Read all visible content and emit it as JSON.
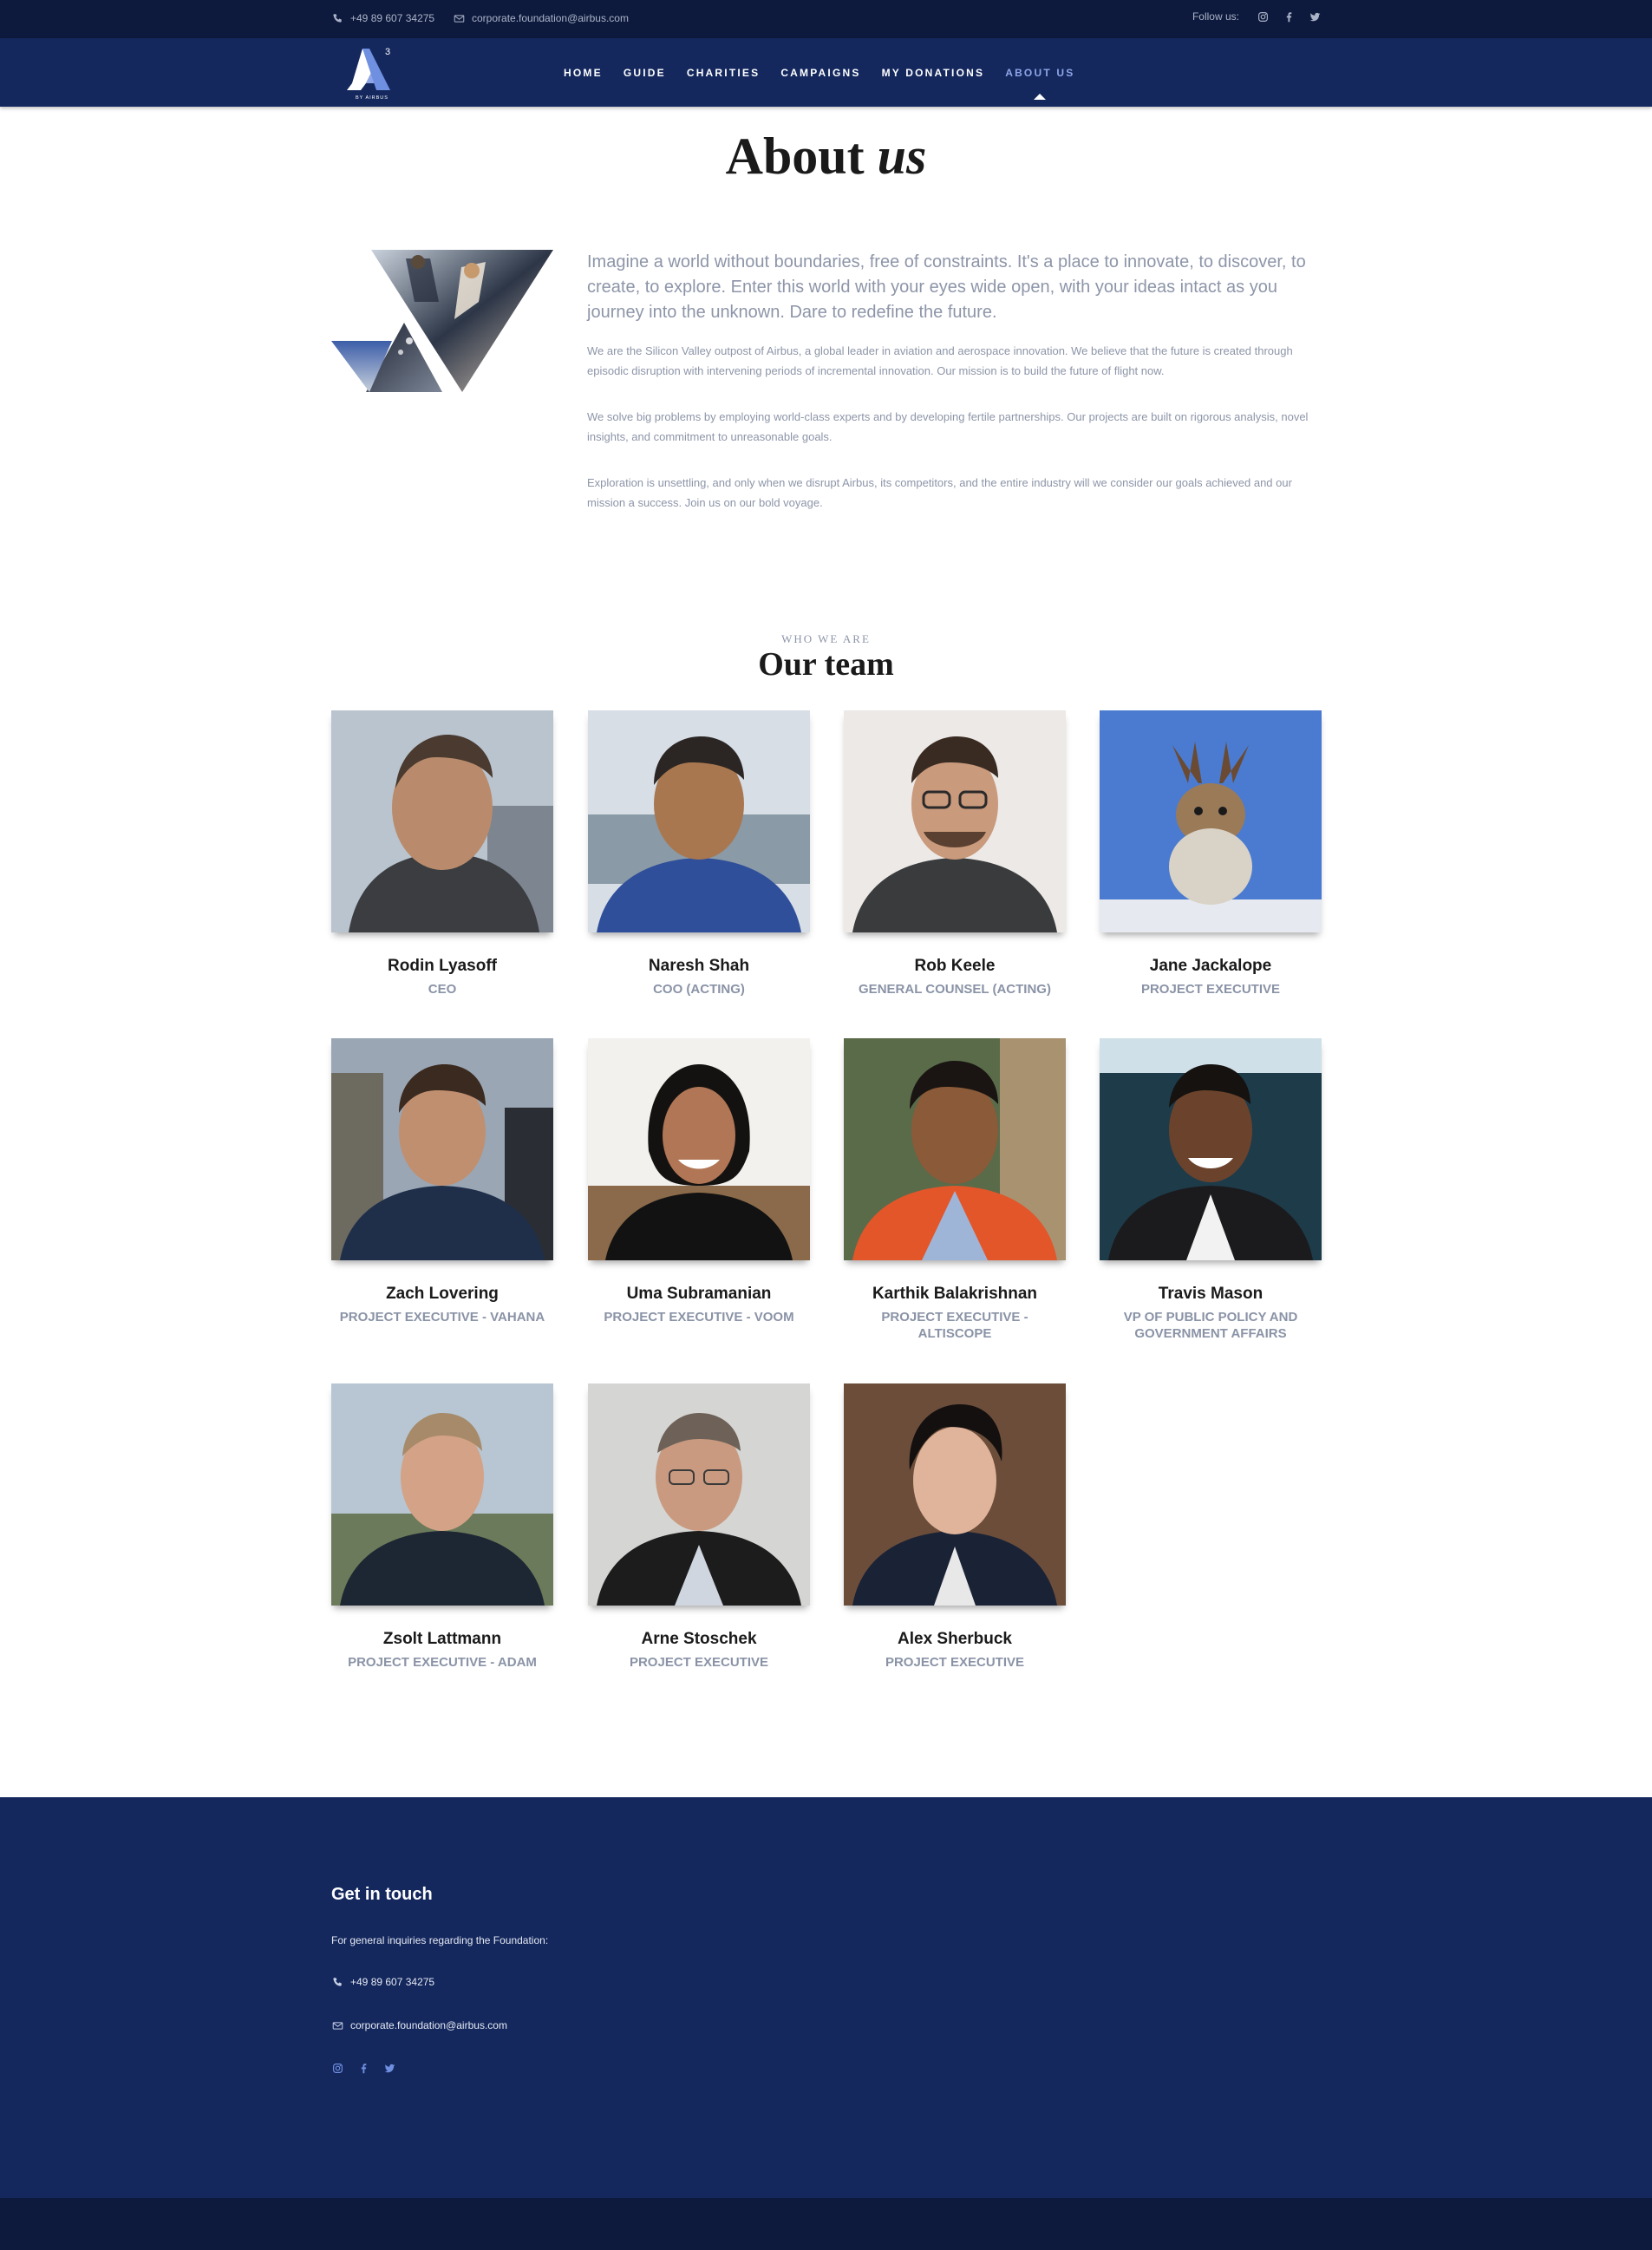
{
  "topbar": {
    "phone": "+49 89 607 34275",
    "email": "corporate.foundation@airbus.com",
    "follow_label": "Follow us:",
    "social_icons": [
      "instagram-icon",
      "facebook-icon",
      "twitter-icon"
    ]
  },
  "brand": {
    "logo_caption": "BY AIRBUS",
    "logo_superscript": "3"
  },
  "nav": {
    "items": [
      "HOME",
      "GUIDE",
      "CHARITIES",
      "CAMPAIGNS",
      "MY DONATIONS",
      "ABOUT US"
    ],
    "active": "ABOUT US"
  },
  "page": {
    "title_main": "About",
    "title_em": "us"
  },
  "intro": {
    "lead": "Imagine a world without boundaries, free of constraints. It's a place to innovate, to discover, to create, to explore. Enter this world with your eyes wide open, with your ideas intact as you journey into the unknown. Dare to redefine the future.",
    "paragraphs": [
      "We are the Silicon Valley outpost of Airbus, a global leader in aviation and aerospace innovation. We believe that the future is created through episodic disruption with intervening periods of incremental innovation. Our mission is to build the future of flight now.",
      "We solve big problems by employing world-class experts and by developing fertile partnerships. Our projects are built on rigorous analysis, novel insights, and commitment to unreasonable goals.",
      "Exploration is unsettling, and only when we disrupt Airbus, its competitors, and the entire industry will we consider our goals achieved and our mission a success. Join us on our bold voyage."
    ]
  },
  "team": {
    "eyebrow": "WHO WE ARE",
    "title": "Our team",
    "members": [
      {
        "name": "Rodin Lyasoff",
        "role": "CEO"
      },
      {
        "name": "Naresh Shah",
        "role": "COO (ACTING)"
      },
      {
        "name": "Rob Keele",
        "role": "GENERAL COUNSEL (ACTING)"
      },
      {
        "name": "Jane Jackalope",
        "role": "PROJECT EXECUTIVE"
      },
      {
        "name": "Zach Lovering",
        "role": "PROJECT EXECUTIVE - VAHANA"
      },
      {
        "name": "Uma Subramanian",
        "role": "PROJECT EXECUTIVE - VOOM"
      },
      {
        "name": "Karthik Balakrishnan",
        "role": "PROJECT EXECUTIVE - ALTISCOPE"
      },
      {
        "name": "Travis Mason",
        "role": "VP OF PUBLIC POLICY AND GOVERNMENT AFFAIRS"
      },
      {
        "name": "Zsolt Lattmann",
        "role": "PROJECT EXECUTIVE - ADAM"
      },
      {
        "name": "Arne Stoschek",
        "role": "PROJECT EXECUTIVE"
      },
      {
        "name": "Alex Sherbuck",
        "role": "PROJECT EXECUTIVE"
      }
    ]
  },
  "footer": {
    "title": "Get in touch",
    "subtitle": "For general inquiries regarding the Foundation:",
    "phone": "+49 89 607 34275",
    "email": "corporate.foundation@airbus.com",
    "social_icons": [
      "instagram-icon",
      "facebook-icon",
      "twitter-icon"
    ]
  },
  "colors": {
    "topbar": "#0e1a3d",
    "navbar": "#14285e",
    "accent": "#8ea6e8",
    "muted_text": "#8d95a8"
  }
}
